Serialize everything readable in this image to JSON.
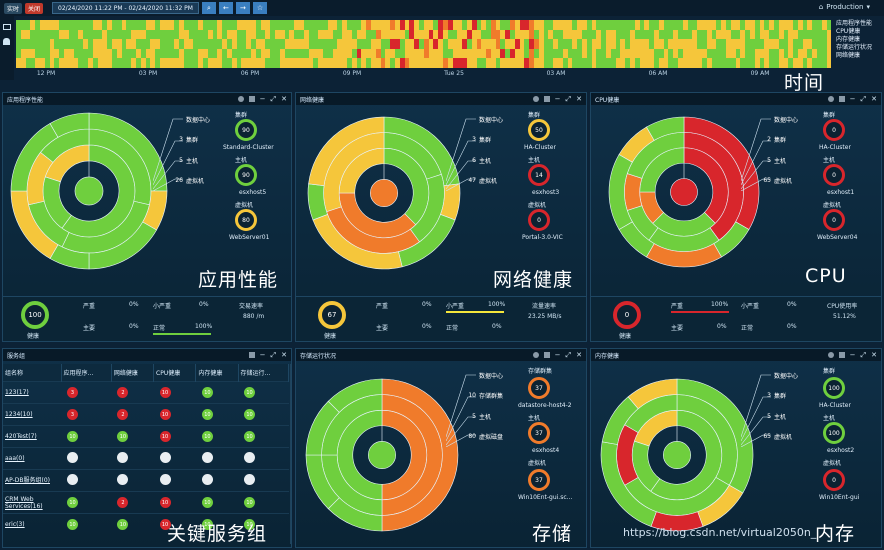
{
  "topbar": {
    "realtime_tag": "实时",
    "close_tag": "关闭",
    "date_range": "02/24/2020 11:22 PM - 02/24/2020 11:32 PM",
    "environment": "Production"
  },
  "timeline": {
    "legend": [
      "应用程序性能",
      "CPU健康",
      "内存健康",
      "存储运行状况",
      "网络健康"
    ],
    "ticks": [
      "12 PM",
      "03 PM",
      "06 PM",
      "09 PM",
      "Tue 25",
      "03 AM",
      "06 AM",
      "09 AM"
    ],
    "big_label": "时间"
  },
  "colors": {
    "green": "#6fcf3e",
    "yellow": "#f5c63b",
    "orange": "#f07b2b",
    "red": "#d8262c",
    "bg": "#0c2236"
  },
  "panels": {
    "app": {
      "title": "应用程序性能",
      "big": "应用性能",
      "levels": [
        {
          "name": "数据中心",
          "value": ""
        },
        {
          "name": "集群",
          "value": "3"
        },
        {
          "name": "主机",
          "value": "5"
        },
        {
          "name": "虚拟机",
          "value": "26"
        }
      ],
      "rings": [
        {
          "label": "集群",
          "value": "90",
          "sub": "Standard-Cluster"
        },
        {
          "label": "主机",
          "value": "90",
          "sub": "esxhost5"
        },
        {
          "label": "虚拟机",
          "value": "80",
          "sub": "WebServer01"
        }
      ],
      "footer": {
        "health_value": "100",
        "health_label": "健康",
        "severe": "严重",
        "severe_pct": "0%",
        "minor": "小严重",
        "minor_pct": "0%",
        "major": "主要",
        "major_pct": "0%",
        "normal": "正常",
        "normal_pct": "100%",
        "metric_label": "交易速率",
        "metric_value": "880 /m"
      }
    },
    "net": {
      "title": "网络健康",
      "big": "网络健康",
      "levels": [
        {
          "name": "数据中心",
          "value": ""
        },
        {
          "name": "集群",
          "value": "3"
        },
        {
          "name": "主机",
          "value": "6"
        },
        {
          "name": "虚拟机",
          "value": "47"
        }
      ],
      "rings": [
        {
          "label": "集群",
          "value": "50",
          "sub": "HA-Cluster"
        },
        {
          "label": "主机",
          "value": "14",
          "sub": "esxhost3"
        },
        {
          "label": "虚拟机",
          "value": "0",
          "sub": "Portal-3.0-VIC"
        }
      ],
      "footer": {
        "health_value": "67",
        "health_label": "健康",
        "severe": "严重",
        "severe_pct": "0%",
        "minor": "小严重",
        "minor_pct": "100%",
        "major": "主要",
        "major_pct": "0%",
        "normal": "正常",
        "normal_pct": "0%",
        "metric_label": "流量速率",
        "metric_value": "23.25 MB/s"
      }
    },
    "cpu": {
      "title": "CPU健康",
      "big": "CPU",
      "levels": [
        {
          "name": "数据中心",
          "value": ""
        },
        {
          "name": "集群",
          "value": "2"
        },
        {
          "name": "主机",
          "value": "5"
        },
        {
          "name": "虚拟机",
          "value": "65"
        }
      ],
      "rings": [
        {
          "label": "集群",
          "value": "0",
          "sub": "HA-Cluster"
        },
        {
          "label": "主机",
          "value": "0",
          "sub": "esxhost1"
        },
        {
          "label": "虚拟机",
          "value": "0",
          "sub": "WebServer04"
        }
      ],
      "footer": {
        "health_value": "0",
        "health_label": "健康",
        "severe": "严重",
        "severe_pct": "100%",
        "minor": "小严重",
        "minor_pct": "0%",
        "major": "主要",
        "major_pct": "0%",
        "normal": "正常",
        "normal_pct": "0%",
        "metric_label": "CPU使用率",
        "metric_value": "51.12%"
      }
    },
    "services": {
      "title": "服务组",
      "big": "关键服务组",
      "columns": [
        "组名称",
        "应用程序...",
        "网络健康",
        "CPU健康",
        "内存健康",
        "存储运行..."
      ],
      "rows": [
        {
          "name": "123(17)",
          "cells": [
            [
              "r",
              "3"
            ],
            [
              "r",
              "2"
            ],
            [
              "r",
              "10"
            ],
            [
              "g",
              "10"
            ],
            [
              "g",
              "10"
            ]
          ]
        },
        {
          "name": "1234(10)",
          "cells": [
            [
              "r",
              "3"
            ],
            [
              "r",
              "2"
            ],
            [
              "r",
              "10"
            ],
            [
              "g",
              "10"
            ],
            [
              "g",
              "10"
            ]
          ]
        },
        {
          "name": "420Test(7)",
          "cells": [
            [
              "g",
              "10"
            ],
            [
              "g",
              "10"
            ],
            [
              "r",
              "10"
            ],
            [
              "g",
              "10"
            ],
            [
              "g",
              "10"
            ]
          ]
        },
        {
          "name": "aaa(0)",
          "cells": [
            [
              "w",
              ""
            ],
            [
              "w",
              ""
            ],
            [
              "w",
              ""
            ],
            [
              "w",
              ""
            ],
            [
              "w",
              ""
            ]
          ]
        },
        {
          "name": "AP-DB服务组(0)",
          "cells": [
            [
              "w",
              ""
            ],
            [
              "w",
              ""
            ],
            [
              "w",
              ""
            ],
            [
              "w",
              ""
            ],
            [
              "w",
              ""
            ]
          ]
        },
        {
          "name": "CRM Web Services(16)",
          "cells": [
            [
              "g",
              "10"
            ],
            [
              "r",
              "2"
            ],
            [
              "r",
              "10"
            ],
            [
              "g",
              "10"
            ],
            [
              "g",
              "10"
            ]
          ]
        },
        {
          "name": "eric(3)",
          "cells": [
            [
              "g",
              "10"
            ],
            [
              "g",
              "10"
            ],
            [
              "r",
              "10"
            ],
            [
              "g",
              "10"
            ],
            [
              "g",
              "10"
            ]
          ]
        }
      ]
    },
    "storage": {
      "title": "存储运行状况",
      "big": "存储",
      "levels": [
        {
          "name": "数据中心",
          "value": ""
        },
        {
          "name": "存储群集",
          "value": "10"
        },
        {
          "name": "主机",
          "value": "5"
        },
        {
          "name": "虚拟磁盘",
          "value": "80"
        }
      ],
      "rings": [
        {
          "label": "存储群集",
          "value": "37",
          "sub": "datastore-host4-2"
        },
        {
          "label": "主机",
          "value": "37",
          "sub": "esxhost4"
        },
        {
          "label": "虚拟机",
          "value": "37",
          "sub": "Win10Ent-gui.sc..."
        }
      ]
    },
    "mem": {
      "title": "内存健康",
      "big": "内存",
      "levels": [
        {
          "name": "数据中心",
          "value": ""
        },
        {
          "name": "集群",
          "value": "3"
        },
        {
          "name": "主机",
          "value": "5"
        },
        {
          "name": "虚拟机",
          "value": "65"
        }
      ],
      "rings": [
        {
          "label": "集群",
          "value": "100",
          "sub": "HA-Cluster"
        },
        {
          "label": "主机",
          "value": "100",
          "sub": "esxhost2"
        },
        {
          "label": "虚拟机",
          "value": "0",
          "sub": "Win10Ent-gui"
        }
      ]
    }
  },
  "watermark": "https://blog.csdn.net/virtual2050n_"
}
